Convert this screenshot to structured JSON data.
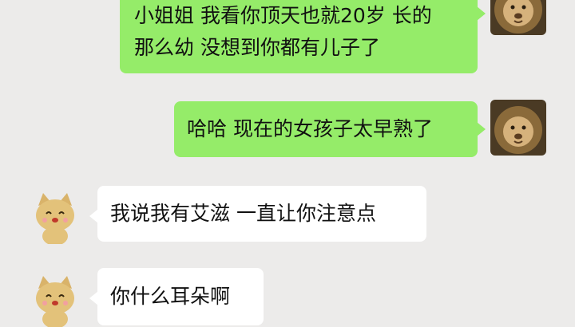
{
  "messages": [
    {
      "side": "out",
      "lines": [
        "小姐姐 我看你顶天也就20岁 长的",
        "那么幼 没想到你都有儿子了"
      ],
      "avatar": "lion-avatar"
    },
    {
      "side": "out",
      "lines": [
        "哈哈 现在的女孩子太早熟了"
      ],
      "avatar": "lion-avatar"
    },
    {
      "side": "in",
      "lines": [
        "我说我有艾滋 一直让你注意点"
      ],
      "avatar": "cat-avatar"
    },
    {
      "side": "in",
      "lines": [
        "你什么耳朵啊"
      ],
      "avatar": "cat-avatar"
    }
  ],
  "colors": {
    "background": "#ecebea",
    "outgoing_bubble": "#95ec69",
    "incoming_bubble": "#ffffff"
  }
}
